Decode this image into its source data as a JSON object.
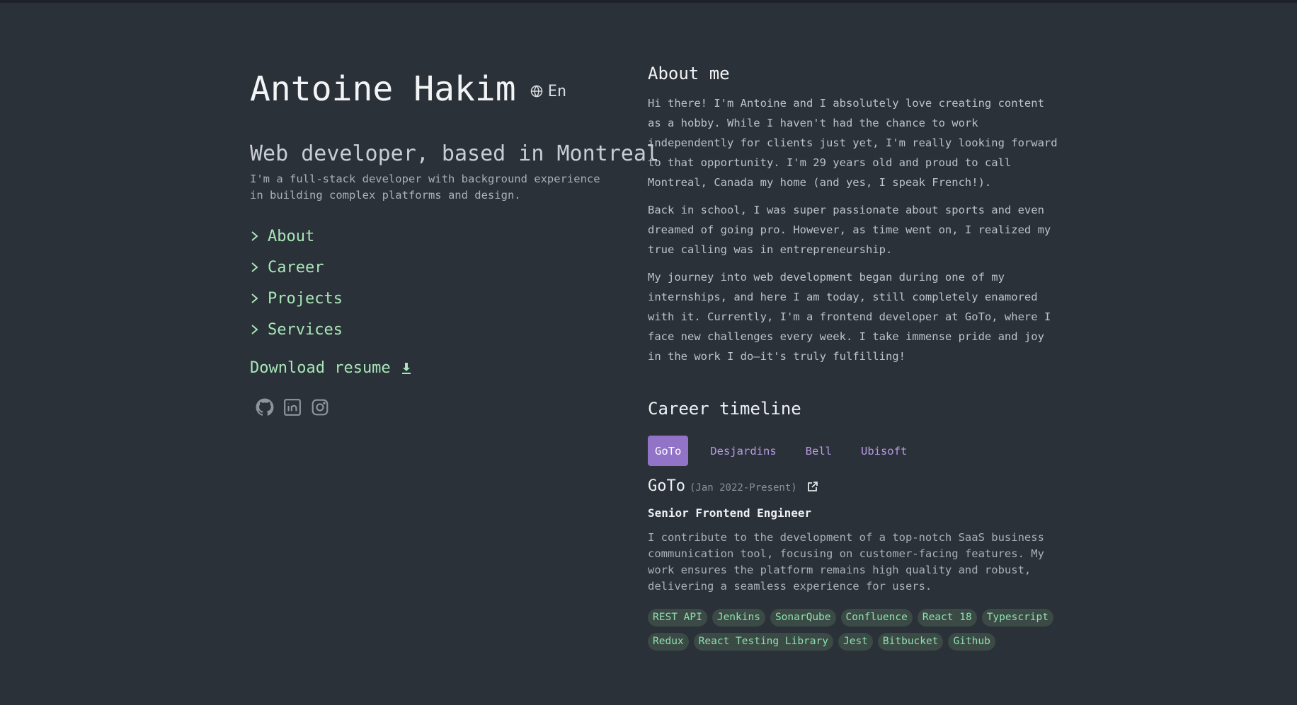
{
  "profile": {
    "name": "Antoine Hakim",
    "language": "En",
    "headline": "Web developer, based in Montreal",
    "intro": "I'm a full-stack developer with background experience in building complex platforms and design."
  },
  "nav": {
    "items": [
      {
        "label": "About"
      },
      {
        "label": "Career"
      },
      {
        "label": "Projects"
      },
      {
        "label": "Services"
      }
    ],
    "download_label": "Download resume"
  },
  "socials": {
    "icons": [
      "github-icon",
      "linkedin-icon",
      "instagram-icon"
    ]
  },
  "about": {
    "title": "About me",
    "paragraphs": [
      "Hi there! I'm Antoine and I absolutely love creating content as a hobby. While I haven't had the chance to work independently for clients just yet, I'm really looking forward to that opportunity. I'm 29 years old and proud to call Montreal, Canada my home (and yes, I speak French!).",
      "Back in school, I was super passionate about sports and even dreamed of going pro. However, as time went on, I realized my true calling was in entrepreneurship.",
      "My journey into web development began during one of my internships, and here I am today, still completely enamored with it. Currently, I'm a frontend developer at GoTo, where I face new challenges every week. I take immense pride and joy in the work I do—it's truly fulfilling!"
    ]
  },
  "career": {
    "title": "Career timeline",
    "tabs": [
      "GoTo",
      "Desjardins",
      "Bell",
      "Ubisoft"
    ],
    "active_tab": "GoTo",
    "job": {
      "company": "GoTo",
      "dates": "(Jan 2022-Present)",
      "role": "Senior Frontend Engineer",
      "description": "I contribute to the development of a top-notch SaaS business communication tool, focusing on customer-facing features. My work ensures the platform remains high quality and robust, delivering a seamless experience for users.",
      "tags": [
        "REST API",
        "Jenkins",
        "SonarQube",
        "Confluence",
        "React 18",
        "Typescript",
        "Redux",
        "React Testing Library",
        "Jest",
        "Bitbucket",
        "Github"
      ]
    }
  },
  "colors": {
    "background": "#2b3139",
    "accent_green": "#a8e6b8",
    "accent_purple": "#9173c7",
    "tag_bg": "#3b4a45"
  }
}
